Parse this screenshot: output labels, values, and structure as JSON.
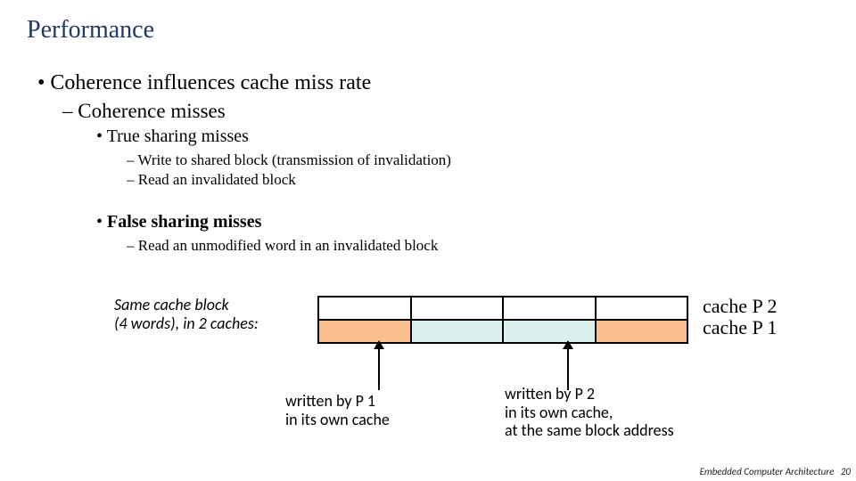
{
  "title": "Performance",
  "bullets": {
    "l1": "Coherence influences cache miss rate",
    "l2": "Coherence misses",
    "l3a": "True sharing misses",
    "l4a": "Write to shared block (transmission of invalidation)",
    "l4b": "Read an invalidated block",
    "l3b": "False sharing misses",
    "l4c": "Read an unmodified word in an invalidated block"
  },
  "diagram": {
    "same_block_line1": "Same cache block",
    "same_block_line2": "(4 words), in 2 caches:",
    "cache_p2": "cache P 2",
    "cache_p1": "cache P 1",
    "caption1_line1": "written by P 1",
    "caption1_line2": "in its own cache",
    "caption2_line1": "written by P 2",
    "caption2_line2": "in its own cache,",
    "caption2_line3": "at the same block address"
  },
  "footer": {
    "label": "Embedded Computer Architecture",
    "page": "20"
  },
  "bullet_glyphs": {
    "dot": "•",
    "dash": "–",
    "ndash": "–"
  }
}
